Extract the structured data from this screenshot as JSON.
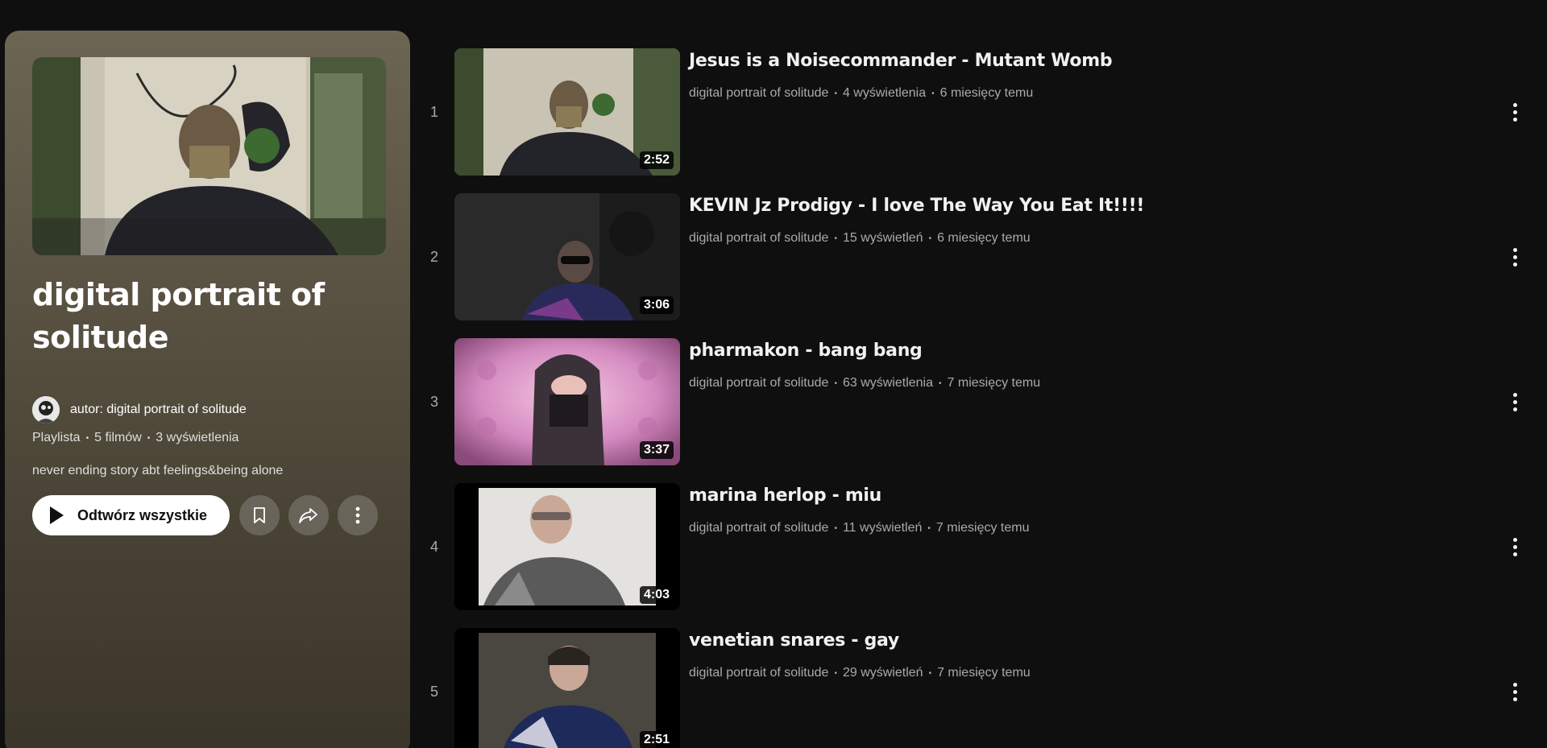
{
  "playlist": {
    "title": "digital portrait of solitude",
    "owner": "autor: digital portrait of solitude",
    "type": "Playlista",
    "video_count": "5 filmów",
    "views": "3 wyświetlenia",
    "description": "never ending story abt feelings&being alone",
    "play_all_label": "Odtwórz wszystkie",
    "background_color": "#5a5343"
  },
  "videos": [
    {
      "index": "1",
      "title": "Jesus is a Noisecommander - Mutant Womb",
      "channel": "digital portrait of solitude",
      "views": "4 wyświetlenia",
      "age": "6 miesięcy temu",
      "duration": "2:52"
    },
    {
      "index": "2",
      "title": "KEVIN Jz Prodigy - I love The Way You Eat It!!!!",
      "channel": "digital portrait of solitude",
      "views": "15 wyświetleń",
      "age": "6 miesięcy temu",
      "duration": "3:06"
    },
    {
      "index": "3",
      "title": "pharmakon - bang bang",
      "channel": "digital portrait of solitude",
      "views": "63 wyświetlenia",
      "age": "7 miesięcy temu",
      "duration": "3:37"
    },
    {
      "index": "4",
      "title": "marina herlop - miu",
      "channel": "digital portrait of solitude",
      "views": "11 wyświetleń",
      "age": "7 miesięcy temu",
      "duration": "4:03"
    },
    {
      "index": "5",
      "title": "venetian snares - gay",
      "channel": "digital portrait of solitude",
      "views": "29 wyświetleń",
      "age": "7 miesięcy temu",
      "duration": "2:51"
    }
  ],
  "icons": {
    "play": "play-icon",
    "save": "bookmark-icon",
    "share": "share-icon",
    "more": "more-vert-icon"
  }
}
